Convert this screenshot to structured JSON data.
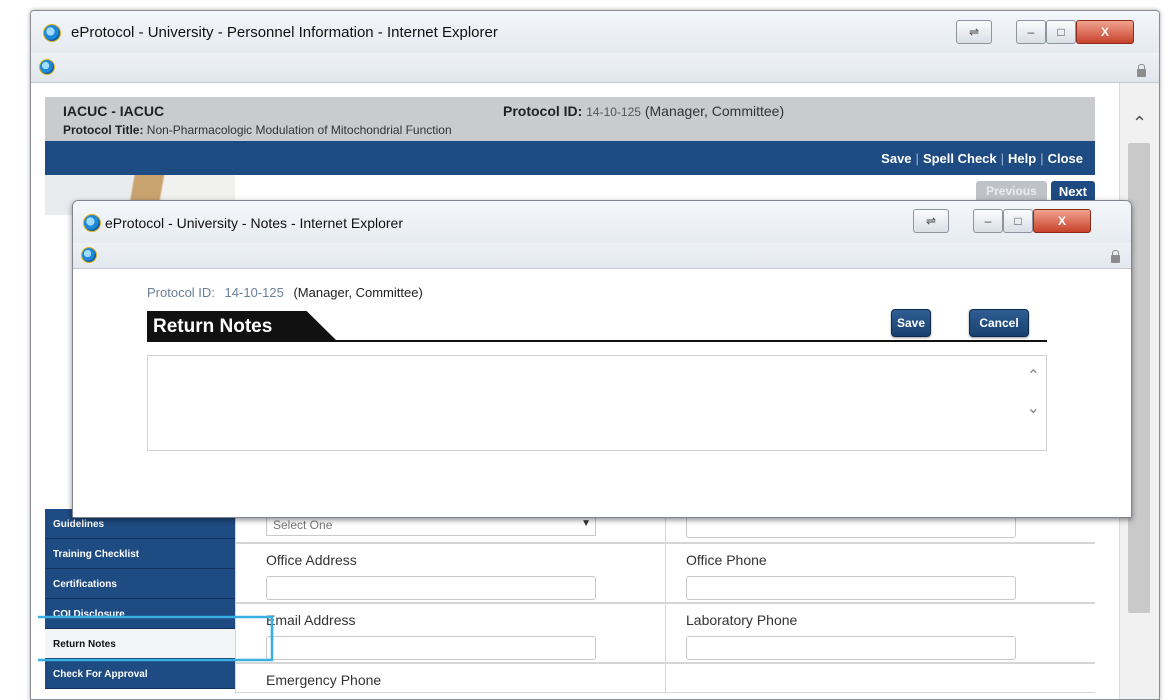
{
  "outer_window": {
    "title": "eProtocol - University - Personnel Information - Internet Explorer",
    "controls": {
      "minimize": "–",
      "maximize": "□",
      "close": "X"
    },
    "header": {
      "committee": "IACUC - IACUC",
      "protocol_title_label": "Protocol Title:",
      "protocol_title": "Non-Pharmacologic Modulation of Mitochondrial Function",
      "protocol_id_label": "Protocol ID:",
      "protocol_id": "14-10-125",
      "role": "(Manager, Committee)"
    },
    "action_links": [
      "Save",
      "Spell Check",
      "Help",
      "Close"
    ],
    "nav_buttons": {
      "previous": "Previous",
      "next": "Next"
    },
    "left_nav": [
      {
        "label": "Guidelines",
        "active": false
      },
      {
        "label": "Training Checklist",
        "active": false
      },
      {
        "label": "Certifications",
        "active": false
      },
      {
        "label": "COI Disclosure",
        "active": false
      },
      {
        "label": "Return Notes",
        "active": true
      },
      {
        "label": "Check For Approval",
        "active": false
      }
    ],
    "form": {
      "select_value": "Select One",
      "office_address_label": "Office Address",
      "office_phone_label": "Office Phone",
      "email_label": "Email Address",
      "lab_phone_label": "Laboratory Phone",
      "emergency_label": "Emergency Phone"
    }
  },
  "notes_window": {
    "title": "eProtocol - University - Notes - Internet Explorer",
    "protocol_id_label": "Protocol ID:",
    "protocol_id": "14-10-125",
    "role": "(Manager, Committee)",
    "section_title": "Return Notes",
    "save_label": "Save",
    "cancel_label": "Cancel",
    "notes_value": ""
  },
  "colors": {
    "nav_blue": "#1d4b82",
    "header_grey": "#c9cbce",
    "highlight": "#3ab0e2"
  }
}
